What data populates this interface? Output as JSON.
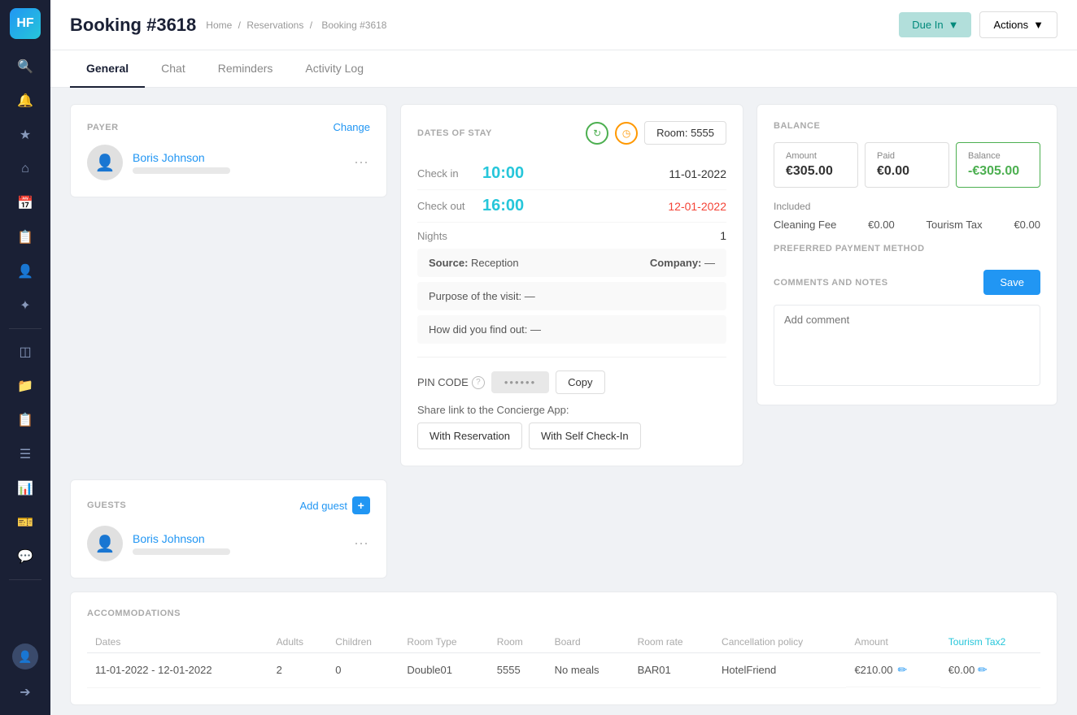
{
  "sidebar": {
    "logo": "HF",
    "icons": [
      {
        "name": "search-icon",
        "symbol": "🔍"
      },
      {
        "name": "bell-icon",
        "symbol": "🔔"
      },
      {
        "name": "star-icon",
        "symbol": "⭐"
      },
      {
        "name": "home-icon",
        "symbol": "🏠"
      },
      {
        "name": "calendar-icon",
        "symbol": "📅"
      },
      {
        "name": "clipboard-icon",
        "symbol": "📋"
      },
      {
        "name": "person-icon",
        "symbol": "👤"
      },
      {
        "name": "tag-icon",
        "symbol": "🏷"
      },
      {
        "name": "grid-icon",
        "symbol": "⊞"
      },
      {
        "name": "folder-icon",
        "symbol": "📁"
      },
      {
        "name": "id-icon",
        "symbol": "🪪"
      },
      {
        "name": "list-icon",
        "symbol": "☰"
      },
      {
        "name": "chart-icon",
        "symbol": "📊"
      },
      {
        "name": "ticket-icon",
        "symbol": "🎫"
      },
      {
        "name": "message-icon",
        "symbol": "💬"
      },
      {
        "name": "user-circle-icon",
        "symbol": "👤"
      },
      {
        "name": "logout-icon",
        "symbol": "⬅"
      }
    ]
  },
  "header": {
    "title": "Booking #3618",
    "breadcrumb_home": "Home",
    "breadcrumb_reservations": "Reservations",
    "breadcrumb_current": "Booking #3618",
    "due_in_label": "Due In",
    "actions_label": "Actions"
  },
  "tabs": [
    {
      "id": "general",
      "label": "General",
      "active": true
    },
    {
      "id": "chat",
      "label": "Chat",
      "active": false
    },
    {
      "id": "reminders",
      "label": "Reminders",
      "active": false
    },
    {
      "id": "activity-log",
      "label": "Activity Log",
      "active": false
    }
  ],
  "payer": {
    "section_label": "PAYER",
    "change_label": "Change",
    "name": "Boris Johnson"
  },
  "guests": {
    "section_label": "GUESTS",
    "add_guest_label": "Add guest",
    "name": "Boris Johnson"
  },
  "stay": {
    "section_label": "DATES OF STAY",
    "room_label": "Room: 5555",
    "checkin_label": "Check in",
    "checkin_time": "10:00",
    "checkin_date": "11-01-2022",
    "checkout_label": "Check out",
    "checkout_time": "16:00",
    "checkout_date": "12-01-2022",
    "nights_label": "Nights",
    "nights_val": "1",
    "source_label": "Source:",
    "source_val": "Reception",
    "company_label": "Company:",
    "company_val": "—",
    "purpose_label": "Purpose of the visit:",
    "purpose_val": "—",
    "howfind_label": "How did you find out:",
    "howfind_val": "—",
    "pincode_label": "PIN CODE",
    "pincode_val": "••••••",
    "copy_label": "Copy",
    "share_label": "Share link to the Concierge App:",
    "with_reservation_label": "With Reservation",
    "with_selfcheckin_label": "With Self Check-In"
  },
  "balance": {
    "section_label": "BALANCE",
    "amount_label": "Amount",
    "amount_val": "€305.00",
    "paid_label": "Paid",
    "paid_val": "€0.00",
    "balance_label": "Balance",
    "balance_val": "-€305.00",
    "included_label": "Included",
    "cleaning_fee_label": "Cleaning Fee",
    "cleaning_fee_val": "€0.00",
    "tourism_tax_label": "Tourism Tax",
    "tourism_tax_val": "€0.00",
    "preferred_payment_label": "PREFERRED PAYMENT METHOD"
  },
  "comments": {
    "section_label": "COMMENTS AND NOTES",
    "save_label": "Save",
    "placeholder": "Add comment"
  },
  "accommodations": {
    "section_label": "ACCOMMODATIONS",
    "columns": [
      "Dates",
      "Adults",
      "Children",
      "Room Type",
      "Room",
      "Board",
      "Room rate",
      "Cancellation policy",
      "Amount",
      "Tourism Tax2"
    ],
    "rows": [
      {
        "dates": "11-01-2022 - 12-01-2022",
        "adults": "2",
        "children": "0",
        "room_type": "Double01",
        "room": "5555",
        "board": "No meals",
        "room_rate": "BAR01",
        "cancellation_policy": "HotelFriend",
        "amount": "€210.00",
        "tourism_tax2": "€0.00"
      }
    ]
  }
}
